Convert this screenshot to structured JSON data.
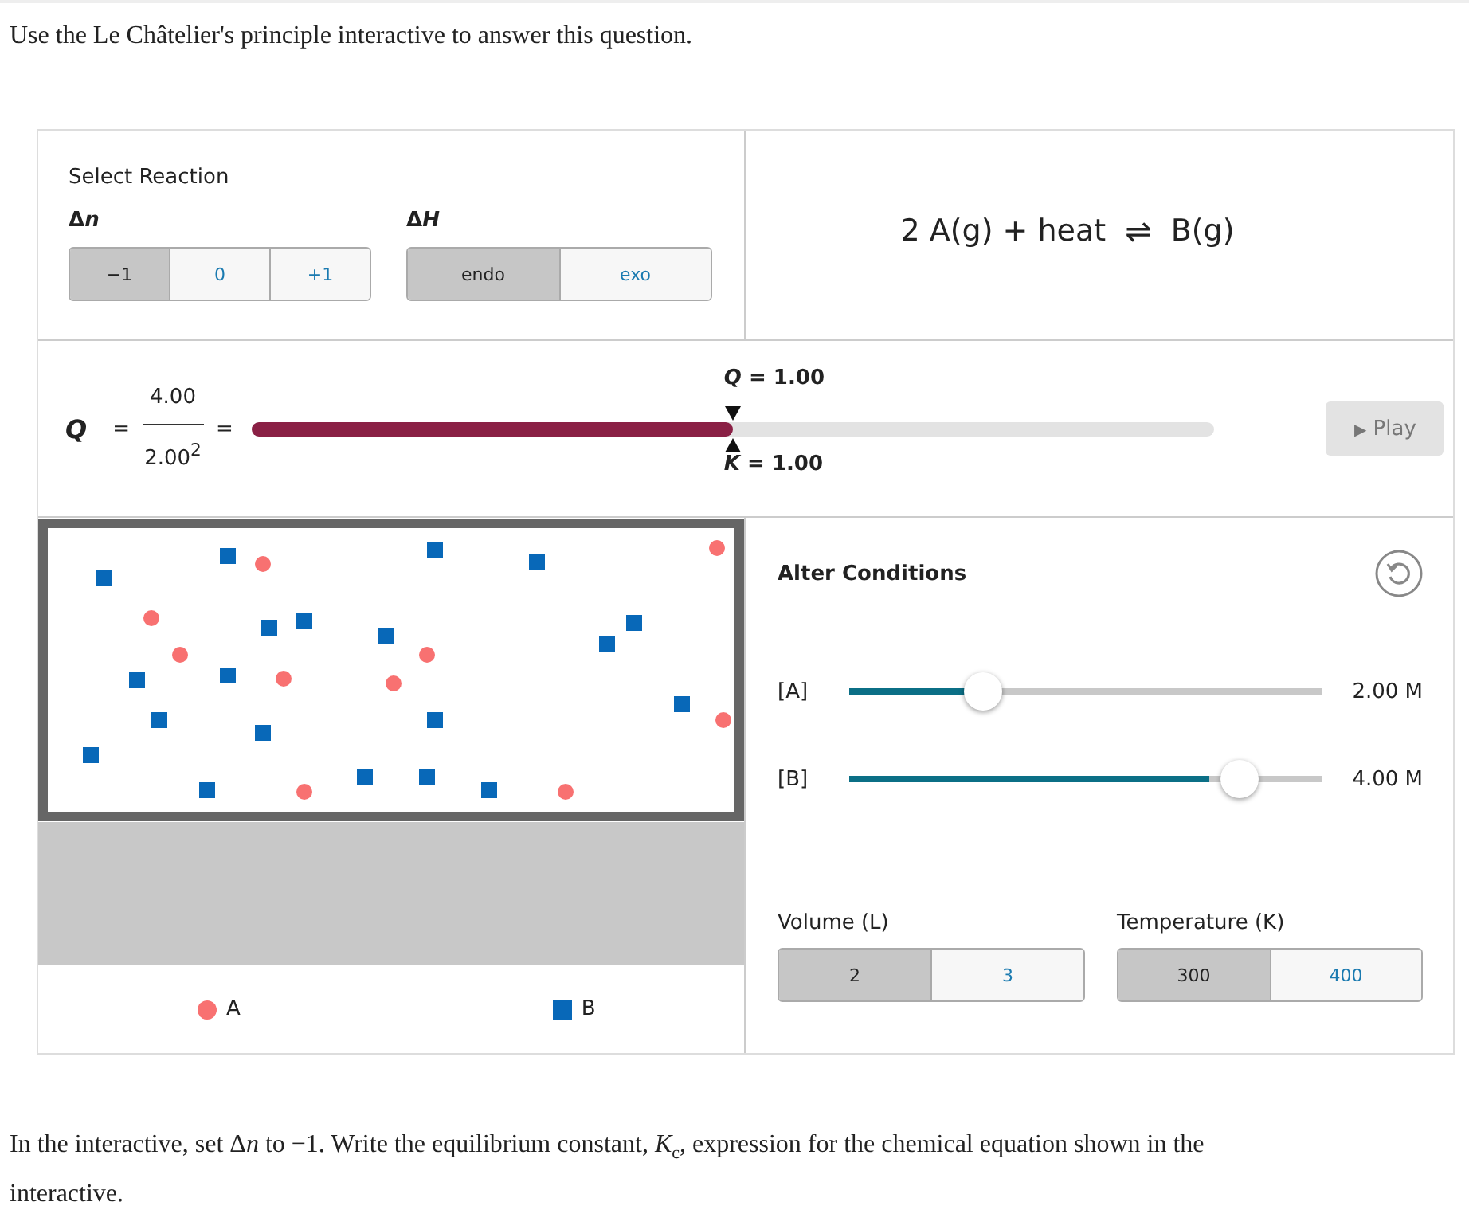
{
  "instruction": "Use the Le Châtelier's principle interactive to answer this question.",
  "reaction": {
    "title": "Select Reaction",
    "groups": [
      {
        "label": [
          {
            "text": "Δ",
            "kind": "text"
          },
          {
            "text": "n",
            "kind": "variable"
          }
        ],
        "options": [
          {
            "label": "−1",
            "selected": true
          },
          {
            "label": "0",
            "selected": false
          },
          {
            "label": "+1",
            "selected": false
          }
        ]
      },
      {
        "label": [
          {
            "text": "Δ",
            "kind": "text"
          },
          {
            "text": "H",
            "kind": "variable"
          }
        ],
        "options": [
          {
            "label": "endo",
            "selected": true
          },
          {
            "label": "exo",
            "selected": false
          }
        ]
      }
    ]
  },
  "equation": {
    "left": "2 A(g) + heat",
    "arrow": "⇌",
    "right": "B(g)"
  },
  "quotient": {
    "symbol": "Q",
    "equals": "=",
    "numerator": "4.00",
    "denominator": "2.00$^{2}$",
    "equals2": "=",
    "level": 0.5,
    "q_label": "*Q* = 1.00",
    "k_label": "*K* = 1.00",
    "play": {
      "icon": "▶",
      "label": "Play",
      "disabled": true
    }
  },
  "legend": [
    {
      "kind": "circle",
      "label": "A",
      "color": "#f87171"
    },
    {
      "kind": "square",
      "label": "B",
      "color": "#0868b8"
    }
  ],
  "conditions": {
    "title": "Alter Conditions",
    "sliders": [
      {
        "label": "[A]",
        "level": 0.26,
        "reading": "2.00 M"
      },
      {
        "label": "[B]",
        "level": 0.76,
        "reading": "4.00 M"
      }
    ],
    "groups": [
      {
        "label": "Volume (L)",
        "options": [
          {
            "label": "2",
            "selected": true
          },
          {
            "label": "3",
            "selected": false
          }
        ]
      },
      {
        "label": "Temperature (K)",
        "options": [
          {
            "label": "300",
            "selected": true
          },
          {
            "label": "400",
            "selected": false
          }
        ]
      }
    ]
  },
  "question": [
    {
      "text": "In the interactive, set Δ",
      "kind": "text"
    },
    {
      "text": "n",
      "kind": "variable"
    },
    {
      "text": " to −1. Write the equilibrium constant, ",
      "kind": "text"
    },
    {
      "text": "K",
      "kind": "variable"
    },
    {
      "text": "c",
      "kind": "subscript"
    },
    {
      "text": ", expression for the chemical equation shown in the interactive.",
      "kind": "text"
    }
  ]
}
